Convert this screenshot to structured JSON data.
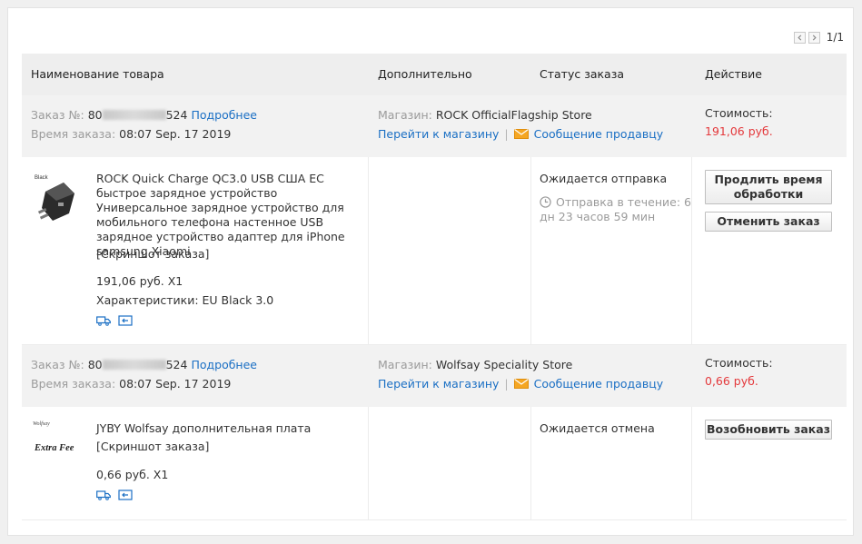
{
  "pager": {
    "text": "1/1"
  },
  "headers": {
    "name": "Наименование товара",
    "extra": "Дополнительно",
    "status": "Статус заказа",
    "action": "Действие"
  },
  "orders": [
    {
      "num_label": "Заказ №:",
      "num_start": "80",
      "num_end": "524",
      "details_link": "Подробнее",
      "time_label": "Время заказа:",
      "time_value": "08:07 Sep. 17 2019",
      "store_label": "Магазин:",
      "store_name": "ROCK OfficialFlagship Store",
      "go_store": "Перейти к магазину",
      "separator": "|",
      "message_seller": "Сообщение продавцу",
      "cost_label": "Стоимость:",
      "cost_value": "191,06 руб.",
      "product_title": "ROCK Quick Charge QC3.0 USB США ЕС быстрое зарядное устройство Универсальное зарядное устройство для мобильного телефона настенное USB зарядное устройство адаптер для iPhone samsung Xiaomi",
      "screenshot": "[Скриншот заказа]",
      "price_qty": "191,06 руб. X1",
      "specs": "Характеристики: EU Black 3.0",
      "thumb_label": "Black",
      "status": "Ожидается отправка",
      "shipping_note": "Отправка в течение: 6 дн 23 часов 59 мин",
      "btn1": "Продлить время обработки",
      "btn2": "Отменить заказ"
    },
    {
      "num_label": "Заказ №:",
      "num_start": "80",
      "num_end": "524",
      "details_link": "Подробнее",
      "time_label": "Время заказа:",
      "time_value": "08:07 Sep. 17 2019",
      "store_label": "Магазин:",
      "store_name": "Wolfsay Speciality Store",
      "go_store": "Перейти к магазину",
      "separator": "|",
      "message_seller": "Сообщение продавцу",
      "cost_label": "Стоимость:",
      "cost_value": "0,66 руб.",
      "product_title": "JYBY Wolfsay дополнительная плата",
      "screenshot": "[Скриншот заказа]",
      "price_qty": "0,66 руб. X1",
      "thumb_brand": "Wolfsay",
      "thumb_text": "Extra Fee",
      "status": "Ожидается отмена",
      "btn1": "Возобновить заказ"
    }
  ]
}
